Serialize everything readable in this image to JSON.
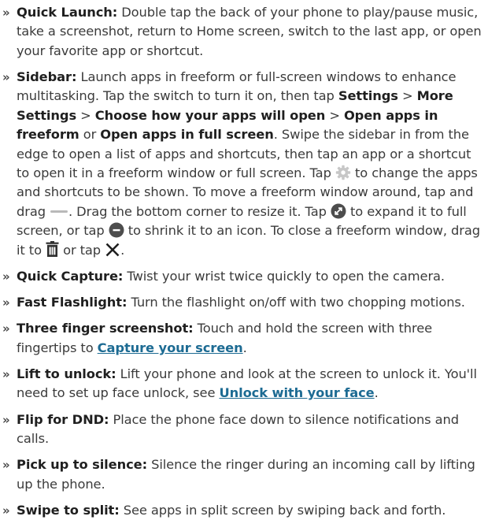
{
  "bullet": "»",
  "colors": {
    "text": "#3b3b3b",
    "link": "#1d6b93",
    "gear_icon": "#c7c7c7",
    "round_icon": "#4d4d4d"
  },
  "items": [
    {
      "term": "Quick Launch:",
      "text": "Double tap the back of your phone to play/pause music, take a screenshot, return to Home screen, switch to the last app, or open your favorite app or shortcut."
    },
    {
      "term": "Sidebar:",
      "t1": "Launch apps in freeform or full-screen windows to enhance multitasking. Tap the switch to turn it on, then tap",
      "s1": "Settings",
      "sep1": ">",
      "s2": "More Settings",
      "sep2": ">",
      "s3": "Choose how your apps will open",
      "sep3": ">",
      "s4": "Open apps in freeform",
      "or1": "or",
      "s5": "Open apps in full screen",
      "t2": ". Swipe the sidebar in from the edge to open a list of apps and shortcuts, then tap an app or a shortcut to open it in a freeform window or full screen. Tap",
      "t3": "to change the apps and shortcuts to be shown. To move a freeform window around, tap and drag",
      "t4": ". Drag the bottom corner to resize it. Tap",
      "t5": "to expand it to full screen, or tap",
      "t6": "to shrink it to an icon. To close a freeform window, drag it to",
      "t7": "or tap",
      "t8": ".",
      "icons": [
        "gear-icon",
        "drag-handle-icon",
        "expand-icon",
        "minimize-icon",
        "trash-icon",
        "close-icon"
      ]
    },
    {
      "term": "Quick Capture:",
      "text": "Twist your wrist twice quickly to open the camera."
    },
    {
      "term": "Fast Flashlight:",
      "text": "Turn the flashlight on/off with two chopping motions."
    },
    {
      "term": "Three finger screenshot:",
      "text": "Touch and hold the screen with three fingertips to",
      "link": "Capture your screen",
      "after": "."
    },
    {
      "term": "Lift to unlock:",
      "text": "Lift your phone and look at the screen to unlock it. You'll need to set up face unlock, see",
      "link": "Unlock with your face",
      "after": "."
    },
    {
      "term": "Flip for DND:",
      "text": "Place the phone face down to silence notifications and calls."
    },
    {
      "term": "Pick up to silence:",
      "text": "Silence the ringer during an incoming call by lifting up the phone."
    },
    {
      "term": "Swipe to split:",
      "text": "See apps in split screen by swiping back and forth."
    }
  ]
}
